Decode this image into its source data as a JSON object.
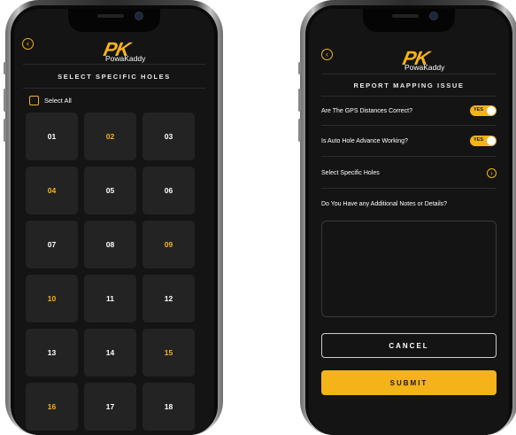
{
  "colors": {
    "accent": "#f5b31a",
    "screen_bg": "#141414",
    "tile_bg": "#232323",
    "text": "#ffffff"
  },
  "brand": {
    "mark": "PK",
    "name": "PowaKaddy"
  },
  "icons": {
    "back": "back-arrow-circle-icon",
    "forward": "forward-arrow-circle-icon",
    "checkbox": "checkbox-icon"
  },
  "select_holes": {
    "title": "SELECT SPECIFIC HOLES",
    "select_all_label": "Select All",
    "holes": [
      {
        "label": "01",
        "selected": false
      },
      {
        "label": "02",
        "selected": true
      },
      {
        "label": "03",
        "selected": false
      },
      {
        "label": "04",
        "selected": true
      },
      {
        "label": "05",
        "selected": false
      },
      {
        "label": "06",
        "selected": false
      },
      {
        "label": "07",
        "selected": false
      },
      {
        "label": "08",
        "selected": false
      },
      {
        "label": "09",
        "selected": true
      },
      {
        "label": "10",
        "selected": true
      },
      {
        "label": "11",
        "selected": false
      },
      {
        "label": "12",
        "selected": false
      },
      {
        "label": "13",
        "selected": false
      },
      {
        "label": "14",
        "selected": false
      },
      {
        "label": "15",
        "selected": true
      },
      {
        "label": "16",
        "selected": true
      },
      {
        "label": "17",
        "selected": false
      },
      {
        "label": "18",
        "selected": false
      }
    ]
  },
  "report": {
    "title": "REPORT MAPPING ISSUE",
    "gps_question": "Are The GPS Distances Correct?",
    "gps_toggle": "YES",
    "auto_hole_question": "Is Auto Hole Advance Working?",
    "auto_hole_toggle": "YES",
    "select_holes_link": "Select Specific Holes",
    "notes_question": "Do You Have any Additional Notes or Details?",
    "notes_value": "",
    "cancel_label": "CANCEL",
    "submit_label": "SUBMIT"
  }
}
